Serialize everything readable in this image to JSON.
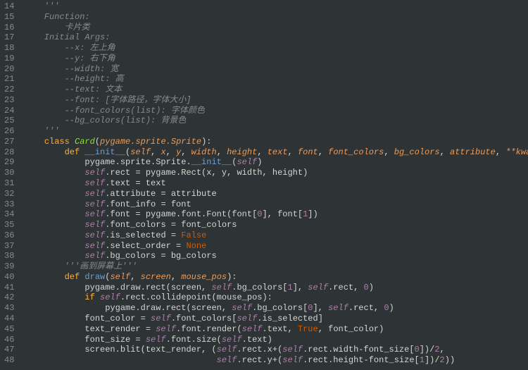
{
  "line_start": 14,
  "line_end": 48,
  "lines": [
    {
      "n": "14",
      "tokens": [
        {
          "t": "    '''",
          "c": "c-comment"
        }
      ]
    },
    {
      "n": "15",
      "tokens": [
        {
          "t": "    Function:",
          "c": "c-comment"
        }
      ]
    },
    {
      "n": "16",
      "tokens": [
        {
          "t": "        卡片类",
          "c": "c-comment"
        }
      ]
    },
    {
      "n": "17",
      "tokens": [
        {
          "t": "    Initial Args:",
          "c": "c-comment"
        }
      ]
    },
    {
      "n": "18",
      "tokens": [
        {
          "t": "        --x: 左上角",
          "c": "c-comment"
        }
      ]
    },
    {
      "n": "19",
      "tokens": [
        {
          "t": "        --y: 右下角",
          "c": "c-comment"
        }
      ]
    },
    {
      "n": "20",
      "tokens": [
        {
          "t": "        --width: 宽",
          "c": "c-comment"
        }
      ]
    },
    {
      "n": "21",
      "tokens": [
        {
          "t": "        --height: 高",
          "c": "c-comment"
        }
      ]
    },
    {
      "n": "22",
      "tokens": [
        {
          "t": "        --text: 文本",
          "c": "c-comment"
        }
      ]
    },
    {
      "n": "23",
      "tokens": [
        {
          "t": "        --font: [字体路径，字体大小]",
          "c": "c-comment"
        }
      ]
    },
    {
      "n": "24",
      "tokens": [
        {
          "t": "        --font_colors(list): 字体颜色",
          "c": "c-comment"
        }
      ]
    },
    {
      "n": "25",
      "tokens": [
        {
          "t": "        --bg_colors(list): 背景色",
          "c": "c-comment"
        }
      ]
    },
    {
      "n": "26",
      "tokens": [
        {
          "t": "    '''",
          "c": "c-comment"
        }
      ]
    },
    {
      "n": "27",
      "tokens": [
        {
          "t": "    ",
          "c": ""
        },
        {
          "t": "class",
          "c": "c-keyword"
        },
        {
          "t": " ",
          "c": ""
        },
        {
          "t": "Card",
          "c": "c-classname"
        },
        {
          "t": "(",
          "c": ""
        },
        {
          "t": "pygame.sprite.Sprite",
          "c": "c-param"
        },
        {
          "t": "):",
          "c": ""
        }
      ]
    },
    {
      "n": "28",
      "tokens": [
        {
          "t": "        ",
          "c": ""
        },
        {
          "t": "def",
          "c": "c-keyword"
        },
        {
          "t": " ",
          "c": ""
        },
        {
          "t": "__init__",
          "c": "c-funcname"
        },
        {
          "t": "(",
          "c": ""
        },
        {
          "t": "self",
          "c": "c-param"
        },
        {
          "t": ", ",
          "c": ""
        },
        {
          "t": "x",
          "c": "c-param"
        },
        {
          "t": ", ",
          "c": ""
        },
        {
          "t": "y",
          "c": "c-param"
        },
        {
          "t": ", ",
          "c": ""
        },
        {
          "t": "width",
          "c": "c-param"
        },
        {
          "t": ", ",
          "c": ""
        },
        {
          "t": "height",
          "c": "c-param"
        },
        {
          "t": ", ",
          "c": ""
        },
        {
          "t": "text",
          "c": "c-param"
        },
        {
          "t": ", ",
          "c": ""
        },
        {
          "t": "font",
          "c": "c-param"
        },
        {
          "t": ", ",
          "c": ""
        },
        {
          "t": "font_colors",
          "c": "c-param"
        },
        {
          "t": ", ",
          "c": ""
        },
        {
          "t": "bg_colors",
          "c": "c-param"
        },
        {
          "t": ", ",
          "c": ""
        },
        {
          "t": "attribute",
          "c": "c-param"
        },
        {
          "t": ", ",
          "c": ""
        },
        {
          "t": "**kwargs",
          "c": "c-param"
        },
        {
          "t": "):",
          "c": ""
        }
      ]
    },
    {
      "n": "29",
      "tokens": [
        {
          "t": "            pygame.sprite.Sprite.",
          "c": ""
        },
        {
          "t": "__init__",
          "c": "c-funcname"
        },
        {
          "t": "(",
          "c": ""
        },
        {
          "t": "self",
          "c": "c-self"
        },
        {
          "t": ")",
          "c": ""
        }
      ]
    },
    {
      "n": "30",
      "tokens": [
        {
          "t": "            ",
          "c": ""
        },
        {
          "t": "self",
          "c": "c-self"
        },
        {
          "t": ".rect = pygame.Rect(x, y, width, height)",
          "c": ""
        }
      ]
    },
    {
      "n": "31",
      "tokens": [
        {
          "t": "            ",
          "c": ""
        },
        {
          "t": "self",
          "c": "c-self"
        },
        {
          "t": ".text = text",
          "c": ""
        }
      ]
    },
    {
      "n": "32",
      "tokens": [
        {
          "t": "            ",
          "c": ""
        },
        {
          "t": "self",
          "c": "c-self"
        },
        {
          "t": ".attribute = attribute",
          "c": ""
        }
      ]
    },
    {
      "n": "33",
      "tokens": [
        {
          "t": "            ",
          "c": ""
        },
        {
          "t": "self",
          "c": "c-self"
        },
        {
          "t": ".font_info = font",
          "c": ""
        }
      ]
    },
    {
      "n": "34",
      "tokens": [
        {
          "t": "            ",
          "c": ""
        },
        {
          "t": "self",
          "c": "c-self"
        },
        {
          "t": ".font = pygame.font.Font(font[",
          "c": ""
        },
        {
          "t": "0",
          "c": "c-num"
        },
        {
          "t": "], font[",
          "c": ""
        },
        {
          "t": "1",
          "c": "c-num"
        },
        {
          "t": "])",
          "c": ""
        }
      ]
    },
    {
      "n": "35",
      "tokens": [
        {
          "t": "            ",
          "c": ""
        },
        {
          "t": "self",
          "c": "c-self"
        },
        {
          "t": ".font_colors = font_colors",
          "c": ""
        }
      ]
    },
    {
      "n": "36",
      "tokens": [
        {
          "t": "            ",
          "c": ""
        },
        {
          "t": "self",
          "c": "c-self"
        },
        {
          "t": ".is_selected = ",
          "c": ""
        },
        {
          "t": "False",
          "c": "c-bool"
        }
      ]
    },
    {
      "n": "37",
      "tokens": [
        {
          "t": "            ",
          "c": ""
        },
        {
          "t": "self",
          "c": "c-self"
        },
        {
          "t": ".select_order = ",
          "c": ""
        },
        {
          "t": "None",
          "c": "c-bool"
        }
      ]
    },
    {
      "n": "38",
      "tokens": [
        {
          "t": "            ",
          "c": ""
        },
        {
          "t": "self",
          "c": "c-self"
        },
        {
          "t": ".bg_colors = bg_colors",
          "c": ""
        }
      ]
    },
    {
      "n": "39",
      "tokens": [
        {
          "t": "        '''画到屏幕上'''",
          "c": "c-comment"
        }
      ]
    },
    {
      "n": "40",
      "tokens": [
        {
          "t": "        ",
          "c": ""
        },
        {
          "t": "def",
          "c": "c-keyword"
        },
        {
          "t": " ",
          "c": ""
        },
        {
          "t": "draw",
          "c": "c-funcname"
        },
        {
          "t": "(",
          "c": ""
        },
        {
          "t": "self",
          "c": "c-param"
        },
        {
          "t": ", ",
          "c": ""
        },
        {
          "t": "screen",
          "c": "c-param"
        },
        {
          "t": ", ",
          "c": ""
        },
        {
          "t": "mouse_pos",
          "c": "c-param"
        },
        {
          "t": "):",
          "c": ""
        }
      ]
    },
    {
      "n": "41",
      "tokens": [
        {
          "t": "            pygame.draw.rect(screen, ",
          "c": ""
        },
        {
          "t": "self",
          "c": "c-self"
        },
        {
          "t": ".bg_colors[",
          "c": ""
        },
        {
          "t": "1",
          "c": "c-num"
        },
        {
          "t": "], ",
          "c": ""
        },
        {
          "t": "self",
          "c": "c-self"
        },
        {
          "t": ".rect, ",
          "c": ""
        },
        {
          "t": "0",
          "c": "c-num"
        },
        {
          "t": ")",
          "c": ""
        }
      ]
    },
    {
      "n": "42",
      "tokens": [
        {
          "t": "            ",
          "c": ""
        },
        {
          "t": "if",
          "c": "c-keyword"
        },
        {
          "t": " ",
          "c": ""
        },
        {
          "t": "self",
          "c": "c-self"
        },
        {
          "t": ".rect.collidepoint(mouse_pos):",
          "c": ""
        }
      ]
    },
    {
      "n": "43",
      "tokens": [
        {
          "t": "                pygame.draw.rect(screen, ",
          "c": ""
        },
        {
          "t": "self",
          "c": "c-self"
        },
        {
          "t": ".bg_colors[",
          "c": ""
        },
        {
          "t": "0",
          "c": "c-num"
        },
        {
          "t": "], ",
          "c": ""
        },
        {
          "t": "self",
          "c": "c-self"
        },
        {
          "t": ".rect, ",
          "c": ""
        },
        {
          "t": "0",
          "c": "c-num"
        },
        {
          "t": ")",
          "c": ""
        }
      ]
    },
    {
      "n": "44",
      "tokens": [
        {
          "t": "            font_color = ",
          "c": ""
        },
        {
          "t": "self",
          "c": "c-self"
        },
        {
          "t": ".font_colors[",
          "c": ""
        },
        {
          "t": "self",
          "c": "c-self"
        },
        {
          "t": ".is_selected]",
          "c": ""
        }
      ]
    },
    {
      "n": "45",
      "tokens": [
        {
          "t": "            text_render = ",
          "c": ""
        },
        {
          "t": "self",
          "c": "c-self"
        },
        {
          "t": ".font.render(",
          "c": ""
        },
        {
          "t": "self",
          "c": "c-self"
        },
        {
          "t": ".text, ",
          "c": ""
        },
        {
          "t": "True",
          "c": "c-bool"
        },
        {
          "t": ", font_color)",
          "c": ""
        }
      ]
    },
    {
      "n": "46",
      "tokens": [
        {
          "t": "            font_size = ",
          "c": ""
        },
        {
          "t": "self",
          "c": "c-self"
        },
        {
          "t": ".font.size(",
          "c": ""
        },
        {
          "t": "self",
          "c": "c-self"
        },
        {
          "t": ".text)",
          "c": ""
        }
      ]
    },
    {
      "n": "47",
      "tokens": [
        {
          "t": "            screen.blit(text_render, (",
          "c": ""
        },
        {
          "t": "self",
          "c": "c-self"
        },
        {
          "t": ".rect.x+(",
          "c": ""
        },
        {
          "t": "self",
          "c": "c-self"
        },
        {
          "t": ".rect.width-font_size[",
          "c": ""
        },
        {
          "t": "0",
          "c": "c-num"
        },
        {
          "t": "])/",
          "c": ""
        },
        {
          "t": "2",
          "c": "c-num"
        },
        {
          "t": ",",
          "c": ""
        }
      ]
    },
    {
      "n": "48",
      "tokens": [
        {
          "t": "                                      ",
          "c": ""
        },
        {
          "t": "self",
          "c": "c-self"
        },
        {
          "t": ".rect.y+(",
          "c": ""
        },
        {
          "t": "self",
          "c": "c-self"
        },
        {
          "t": ".rect.height-font_size[",
          "c": ""
        },
        {
          "t": "1",
          "c": "c-num"
        },
        {
          "t": "])/",
          "c": ""
        },
        {
          "t": "2",
          "c": "c-num"
        },
        {
          "t": "))",
          "c": ""
        }
      ]
    }
  ]
}
